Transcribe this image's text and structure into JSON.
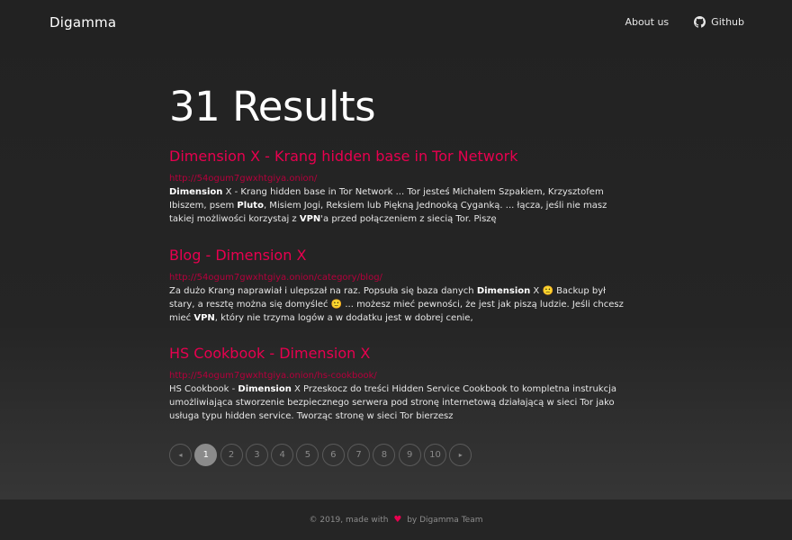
{
  "navbar": {
    "brand": "Digamma",
    "about_label": "About us",
    "github_label": "Github"
  },
  "results_title": "31 Results",
  "results": [
    {
      "title": "Dimension X - Krang hidden base in Tor Network",
      "url": "http://54ogum7gwxhtgiya.onion/",
      "snippet_html": "<b>Dimension</b> X - Krang hidden base in Tor Network ... Tor jesteś Michałem Szpakiem, Krzysztofem Ibiszem, psem <b>Pluto</b>, Misiem Jogi, Reksiem lub Piękną Jednooką Cyganką. ... łącza, jeśli nie masz takiej możliwości korzystaj z <b>VPN</b>'a przed połączeniem z siecią Tor. Piszę"
    },
    {
      "title": "Blog - Dimension X",
      "url": "http://54ogum7gwxhtgiya.onion/category/blog/",
      "snippet_html": "Za dużo Krang naprawiał i ulepszał na raz. Popsuła się baza danych <b>Dimension</b> X 🙁 Backup był stary, a resztę można się domyśleć 🙂 ... możesz mieć pewności, że jest jak piszą ludzie. Jeśli chcesz mieć <b>VPN</b>, który nie trzyma logów a w dodatku jest w dobrej cenie,"
    },
    {
      "title": "HS Cookbook - Dimension X",
      "url": "http://54ogum7gwxhtgiya.onion/hs-cookbook/",
      "snippet_html": "HS Cookbook - <b>Dimension</b> X Przeskocz do treści Hidden Service Cookbook to kompletna instrukcja umożliwiająca stworzenie bezpiecznego serwera pod stronę internetową działającą w sieci Tor jako usługa typu hidden service. Tworząc stronę w sieci Tor bierzesz"
    }
  ],
  "pagination": {
    "prev": "◂",
    "next": "▸",
    "pages": [
      "1",
      "2",
      "3",
      "4",
      "5",
      "6",
      "7",
      "8",
      "9",
      "10"
    ],
    "current": "1"
  },
  "footer": {
    "prefix": "© 2019, made with",
    "heart": "♥",
    "suffix": "by Digamma Team"
  },
  "colors": {
    "accent": "#e8004f",
    "url": "#b5003c",
    "background": "#222222"
  }
}
